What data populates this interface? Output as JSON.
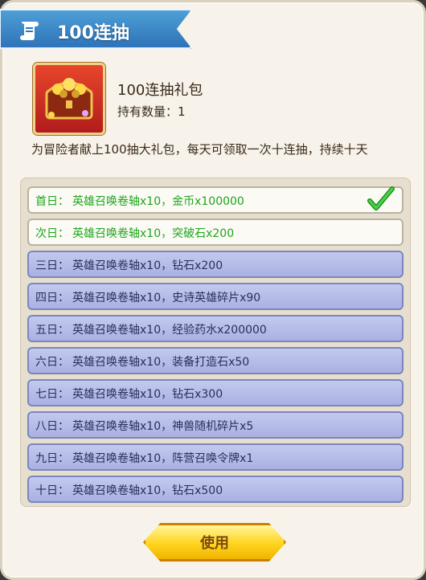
{
  "dialog": {
    "title": "100连抽",
    "item_name": "100连抽礼包",
    "item_count_label": "持有数量：1",
    "description": "为冒险者献上100抽大礼包，每天可领取一次十连抽，持续十天",
    "use_button_label": "使用"
  },
  "rewards": [
    {
      "day": "首日：",
      "text": "英雄召唤卷轴x10，金币x100000",
      "status": "claimed",
      "checked": true
    },
    {
      "day": "次日：",
      "text": "英雄召唤卷轴x10，突破石x200",
      "status": "claimed",
      "checked": false
    },
    {
      "day": "三日：",
      "text": "英雄召唤卷轴x10，钻石x200",
      "status": "locked"
    },
    {
      "day": "四日：",
      "text": "英雄召唤卷轴x10，史诗英雄碎片x90",
      "status": "locked"
    },
    {
      "day": "五日：",
      "text": "英雄召唤卷轴x10，经验药水x200000",
      "status": "locked"
    },
    {
      "day": "六日：",
      "text": "英雄召唤卷轴x10，装备打造石x50",
      "status": "locked"
    },
    {
      "day": "七日：",
      "text": "英雄召唤卷轴x10，钻石x300",
      "status": "locked"
    },
    {
      "day": "八日：",
      "text": "英雄召唤卷轴x10，神兽随机碎片x5",
      "status": "locked"
    },
    {
      "day": "九日：",
      "text": "英雄召唤卷轴x10，阵营召唤令牌x1",
      "status": "locked"
    },
    {
      "day": "十日：",
      "text": "英雄召唤卷轴x10，钻石x500",
      "status": "locked"
    }
  ],
  "colors": {
    "claimed_text": "#1ea51e",
    "locked_text": "#2a2f5a",
    "accent": "#ffd41e"
  }
}
